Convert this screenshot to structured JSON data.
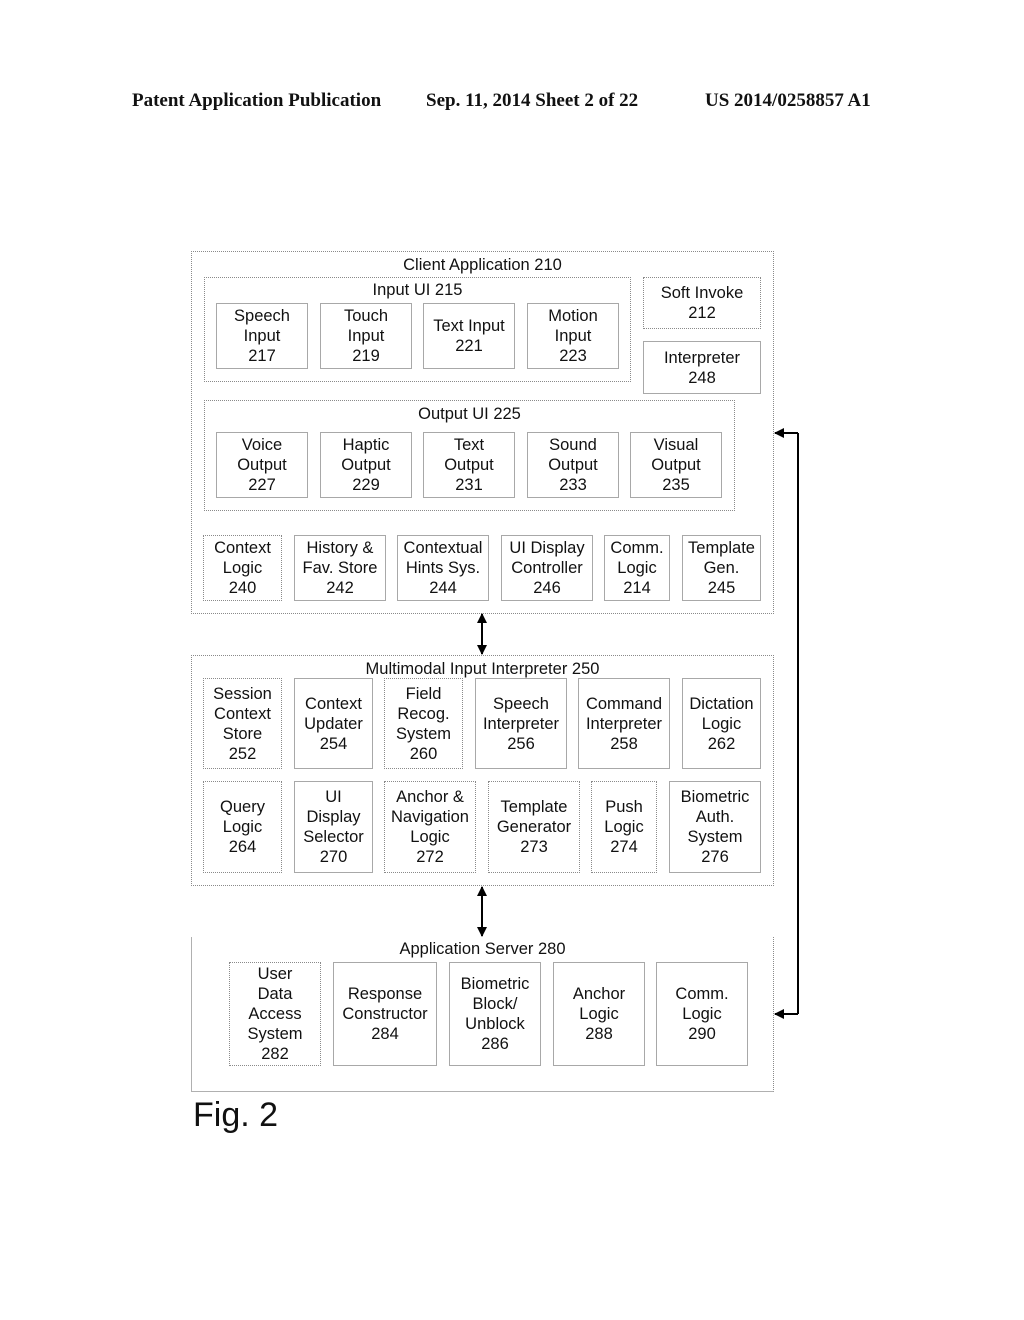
{
  "header": {
    "left": "Patent Application Publication",
    "date_sheet": "Sep. 11, 2014   Sheet 2 of 22",
    "number": "US 2014/0258857 A1"
  },
  "client_app": {
    "title": "Client Application 210",
    "input_ui": {
      "title": "Input UI 215",
      "items": [
        "Speech\nInput\n217",
        "Touch\nInput\n219",
        "Text Input\n221",
        "Motion\nInput\n223"
      ]
    },
    "soft_invoke": "Soft Invoke\n212",
    "interpreter": "Interpreter\n248",
    "output_ui": {
      "title": "Output UI 225",
      "items": [
        "Voice\nOutput\n227",
        "Haptic\nOutput\n229",
        "Text\nOutput\n231",
        "Sound\nOutput\n233",
        "Visual\nOutput\n235"
      ]
    },
    "logic_items": [
      "Context\nLogic\n240",
      "History &\nFav. Store\n242",
      "Contextual\nHints Sys.\n244",
      "UI Display\nController\n246",
      "Comm.\nLogic\n214",
      "Template\nGen.\n245"
    ]
  },
  "interpreter_250": {
    "title": "Multimodal Input Interpreter 250",
    "row1": [
      "Session\nContext\nStore\n252",
      "Context\nUpdater\n254",
      "Field\nRecog.\nSystem\n260",
      "Speech\nInterpreter\n256",
      "Command\nInterpreter\n258",
      "Dictation\nLogic\n262"
    ],
    "row2": [
      "Query\nLogic\n264",
      "UI\nDisplay\nSelector\n270",
      "Anchor &\nNavigation\nLogic\n272",
      "Template\nGenerator\n273",
      "Push\nLogic\n274",
      "Biometric\nAuth.\nSystem\n276"
    ]
  },
  "app_server": {
    "title": "Application Server 280",
    "items": [
      "User\nData\nAccess\nSystem\n282",
      "Response\nConstructor\n284",
      "Biometric\nBlock/\nUnblock\n286",
      "Anchor\nLogic\n288",
      "Comm.\nLogic\n290"
    ]
  },
  "figure_label": "Fig. 2"
}
